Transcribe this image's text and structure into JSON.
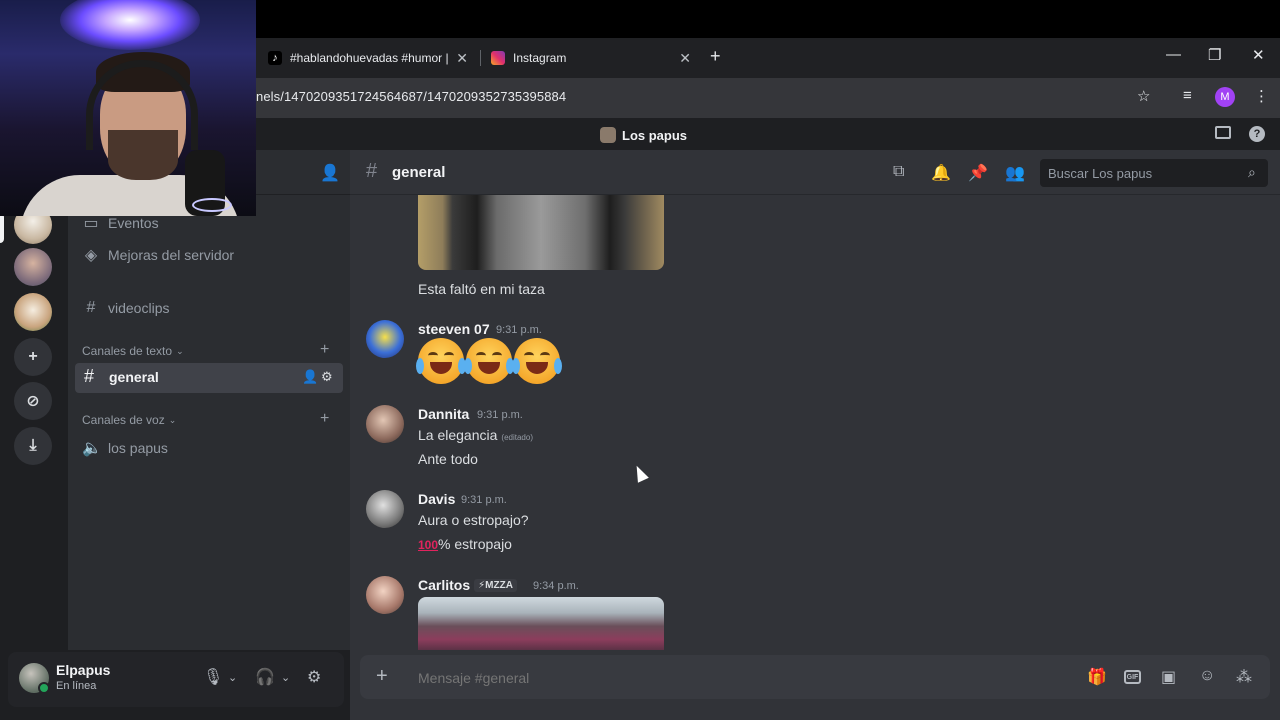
{
  "browser": {
    "tabs": [
      {
        "label": "#hablandohuevadas #humor | t",
        "icon": "tiktok-icon"
      },
      {
        "label": "Instagram",
        "icon": "instagram-icon"
      }
    ],
    "url": "nels/1470209351724564687/1470209352735395884",
    "profile_initial": "M"
  },
  "discord": {
    "server_name": "Los papus",
    "sidebar": {
      "items": [
        {
          "label": "Eventos",
          "icon": "calendar-icon"
        },
        {
          "label": "Mejoras del servidor",
          "icon": "boost-icon"
        },
        {
          "label": "videoclips",
          "icon": "hash-icon"
        }
      ],
      "text_category": "Canales de texto",
      "active_channel": "general",
      "voice_category": "Canales de voz",
      "voice_channels": [
        {
          "label": "los papus",
          "icon": "speaker-icon"
        }
      ]
    },
    "user": {
      "name": "Elpapus",
      "status": "En línea"
    },
    "channel": {
      "name": "general",
      "search_placeholder": "Buscar Los papus"
    },
    "messages": [
      {
        "text": "Esta faltó en mi taza"
      },
      {
        "author": "steeven 07",
        "time": "9:31 p.m.",
        "emoji_count": 3
      },
      {
        "author": "Dannita",
        "time": "9:31 p.m.",
        "lines": [
          "La elegancia",
          "Ante todo"
        ],
        "edited": "(editado)"
      },
      {
        "author": "Davis",
        "time": "9:31 p.m.",
        "lines": [
          "Aura o estropajo?",
          "% estropajo"
        ],
        "emoji_prefix": "100"
      },
      {
        "author": "Carlitos",
        "badge": "⚡MZZA",
        "time": "9:34 p.m."
      }
    ],
    "composer_placeholder": "Mensaje #general"
  },
  "colors": {
    "rail": "#1e1f22",
    "sidebar": "#2b2d31",
    "chat": "#313338",
    "online": "#23a55a",
    "active_channel_bg": "#404249"
  }
}
